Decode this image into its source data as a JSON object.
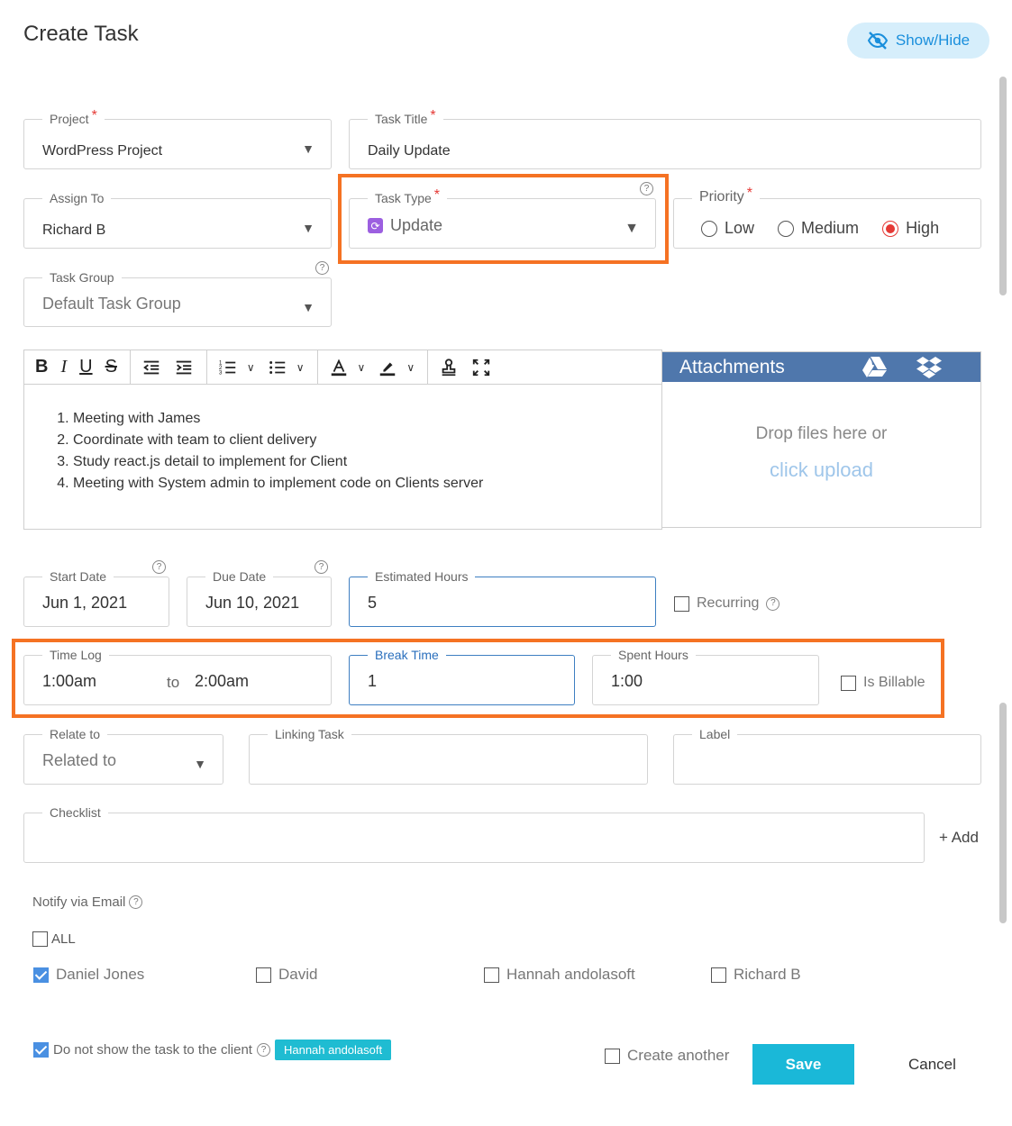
{
  "page": {
    "title": "Create Task",
    "show_hide": "Show/Hide"
  },
  "fields": {
    "project": {
      "label": "Project",
      "value": "WordPress Project"
    },
    "task_title": {
      "label": "Task Title",
      "value": "Daily Update"
    },
    "assign_to": {
      "label": "Assign To",
      "value": "Richard B"
    },
    "task_type": {
      "label": "Task Type",
      "value": "Update"
    },
    "priority": {
      "label": "Priority",
      "options": [
        "Low",
        "Medium",
        "High"
      ],
      "selected": "High"
    },
    "task_group": {
      "label": "Task Group",
      "value": "Default Task Group"
    },
    "start_date": {
      "label": "Start Date",
      "value": "Jun 1, 2021"
    },
    "due_date": {
      "label": "Due Date",
      "value": "Jun 10, 2021"
    },
    "estimated_hours": {
      "label": "Estimated Hours",
      "value": "5"
    },
    "recurring": {
      "label": "Recurring",
      "checked": false
    },
    "time_log": {
      "label": "Time Log",
      "from": "1:00am",
      "to_word": "to",
      "to": "2:00am"
    },
    "break_time": {
      "label": "Break Time",
      "value": "1"
    },
    "spent_hours": {
      "label": "Spent Hours",
      "value": "1:00"
    },
    "is_billable": {
      "label": "Is Billable",
      "checked": false
    },
    "relate_to": {
      "label": "Relate to",
      "value": "Related to"
    },
    "linking_task": {
      "label": "Linking Task",
      "value": ""
    },
    "label": {
      "label": "Label",
      "value": ""
    },
    "checklist": {
      "label": "Checklist",
      "value": "",
      "add": "+ Add"
    }
  },
  "editor": {
    "items": [
      "Meeting with James",
      "Coordinate with team to client delivery",
      "Study react.js detail to implement for Client",
      "Meeting with System admin to implement code on Clients server"
    ]
  },
  "attachments": {
    "title": "Attachments",
    "drop_text": "Drop files here or",
    "upload_link": "click upload"
  },
  "notify": {
    "label": "Notify via Email",
    "all": {
      "label": "ALL",
      "checked": false
    },
    "users": [
      {
        "name": "Daniel Jones",
        "checked": true
      },
      {
        "name": "David",
        "checked": false
      },
      {
        "name": "Hannah andolasoft",
        "checked": false
      },
      {
        "name": "Richard B",
        "checked": false
      }
    ]
  },
  "footer": {
    "hide_from_client": {
      "label": "Do not show the task to the client",
      "checked": true,
      "badge": "Hannah andolasoft"
    },
    "create_another": {
      "label": "Create another",
      "checked": false
    },
    "save": "Save",
    "cancel": "Cancel"
  },
  "colors": {
    "highlight": "#f57223",
    "accent": "#1ab8d8",
    "header_blue": "#4f77ac",
    "required": "#e53935"
  }
}
